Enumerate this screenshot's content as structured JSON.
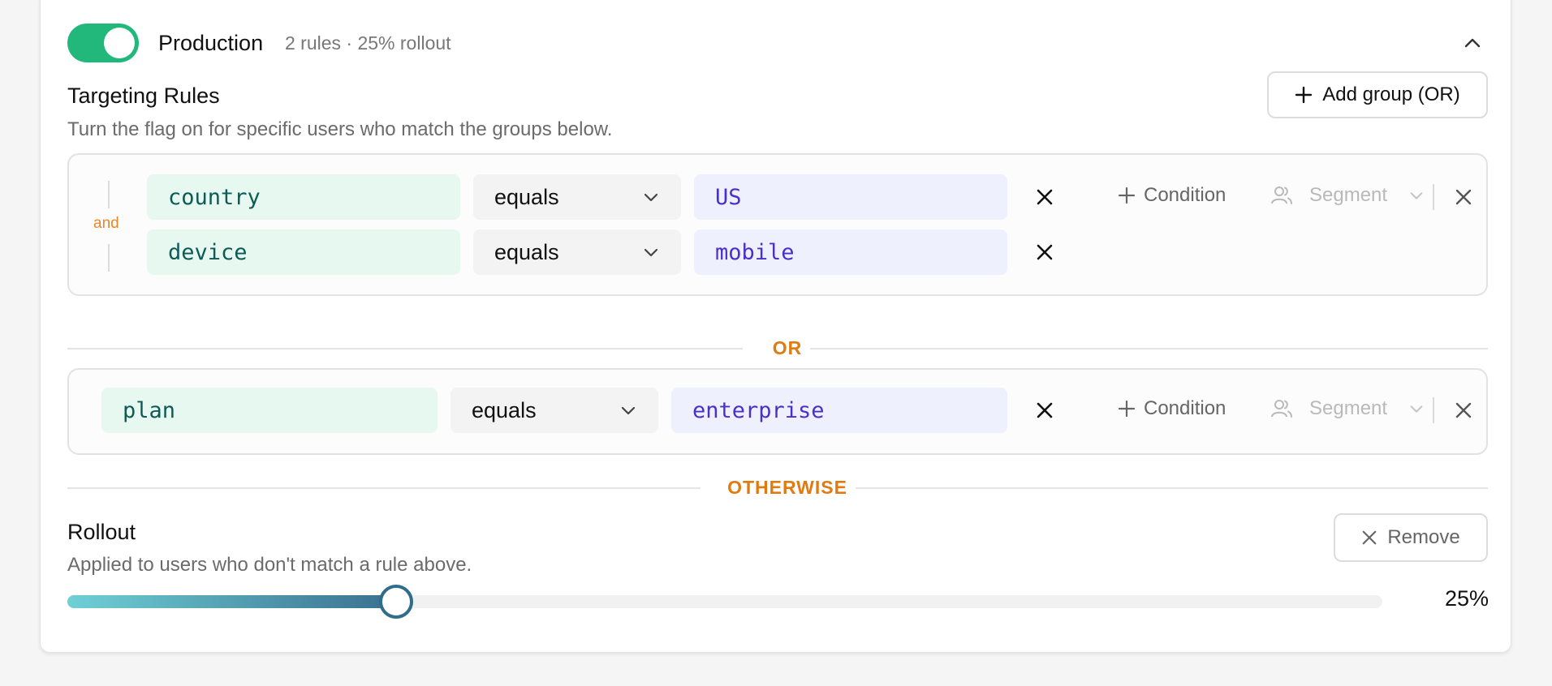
{
  "environment": {
    "enabled": true,
    "name": "Production",
    "summary": "2 rules · 25% rollout"
  },
  "targeting": {
    "title": "Targeting Rules",
    "description": "Turn the flag on for specific users who match the groups below.",
    "add_group_label": "Add group (OR)",
    "groups": [
      {
        "conjunction": "and",
        "conditions": [
          {
            "attribute": "country",
            "operator": "equals",
            "value": "US"
          },
          {
            "attribute": "device",
            "operator": "equals",
            "value": "mobile"
          }
        ]
      },
      {
        "conditions": [
          {
            "attribute": "plan",
            "operator": "equals",
            "value": "enterprise"
          }
        ]
      }
    ],
    "condition_label": "Condition",
    "segment_label": "Segment",
    "or_label": "OR",
    "otherwise_label": "OTHERWISE"
  },
  "rollout": {
    "title": "Rollout",
    "description": "Applied to users who don't match a rule above.",
    "remove_label": "Remove",
    "percent": 25,
    "percent_label": "25%"
  },
  "colors": {
    "toggle_on": "#22b87c",
    "attr_bg": "#e6f8f0",
    "value_bg": "#eef1fd",
    "accent_orange": "#e07b12",
    "slider_start": "#6fd0d6",
    "slider_end": "#3a6f8f"
  },
  "icons": [
    "chevron-up-icon",
    "plus-icon",
    "close-icon",
    "chevron-down-icon",
    "users-icon"
  ]
}
